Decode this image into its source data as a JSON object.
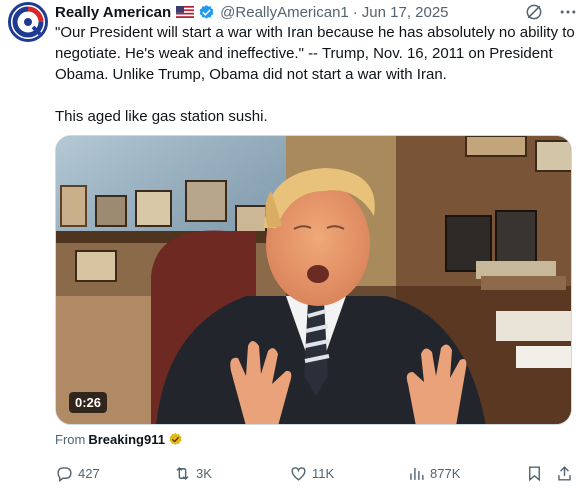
{
  "author": {
    "display_name": "Really American",
    "handle": "@ReallyAmerican1",
    "date": "Jun 17, 2025",
    "separator": "·",
    "flag_icon": "us-flag-icon",
    "verified_icon": "verified-badge-icon"
  },
  "body": {
    "paragraph_1": "\"Our President will start a war with Iran because he has absolutely no ability to negotiate. He's weak and ineffective.\" -- Trump, Nov. 16, 2011 on President Obama.  Unlike Trump, Obama did not start a war with Iran.",
    "paragraph_2": "This aged like gas station sushi."
  },
  "media": {
    "duration": "0:26"
  },
  "attribution": {
    "prefix": "From",
    "source": "Breaking911",
    "badge_color": "#e2b719"
  },
  "actions": {
    "replies": "427",
    "reposts": "3K",
    "likes": "11K",
    "views": "877K"
  },
  "colors": {
    "text": "#0f1419",
    "secondary": "#536471",
    "verified": "#1d9bf0"
  }
}
